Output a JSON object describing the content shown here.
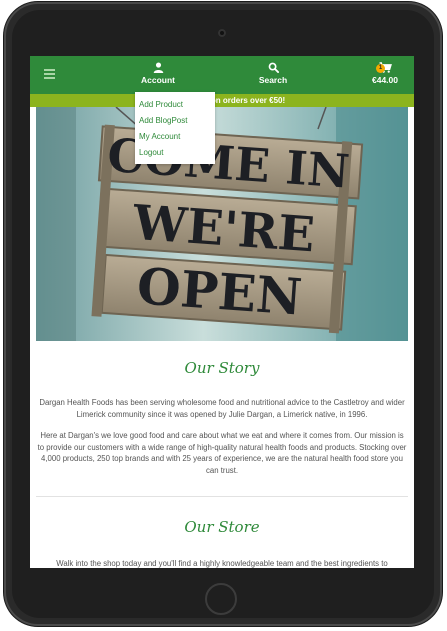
{
  "navbar": {
    "account_label": "Account",
    "search_label": "Search",
    "cart_total": "€44.00",
    "cart_count": "1",
    "colors": {
      "brand_green": "#2f8a3a",
      "banner_green": "#8cb41e",
      "badge": "#f2a900"
    }
  },
  "banner": {
    "text": "on orders over €50!"
  },
  "account_menu": {
    "items": [
      {
        "label": "Add Product"
      },
      {
        "label": "Add BlogPost"
      },
      {
        "label": "My Account"
      },
      {
        "label": "Logout"
      }
    ]
  },
  "hero": {
    "sign_lines": [
      "COME IN",
      "WE'RE",
      "OPEN"
    ]
  },
  "story": {
    "title": "Our Story",
    "paragraph1": "Dargan Health Foods has been serving wholesome food and nutritional advice to the Castletroy and wider Limerick community since it was opened by Julie Dargan, a Limerick native, in 1996.",
    "paragraph2": "Here at Dargan's we love good food and care about what we eat and where it comes from. Our mission is to provide our customers with a wide range of high-quality natural health foods and products. Stocking over 4,000 products, 250 top brands and with 25 years of experience, we are the natural health food store you can trust."
  },
  "store": {
    "title": "Our Store",
    "paragraph1": "Walk into the shop today and you'll find a highly knowledgeable team and the best ingredients to"
  }
}
